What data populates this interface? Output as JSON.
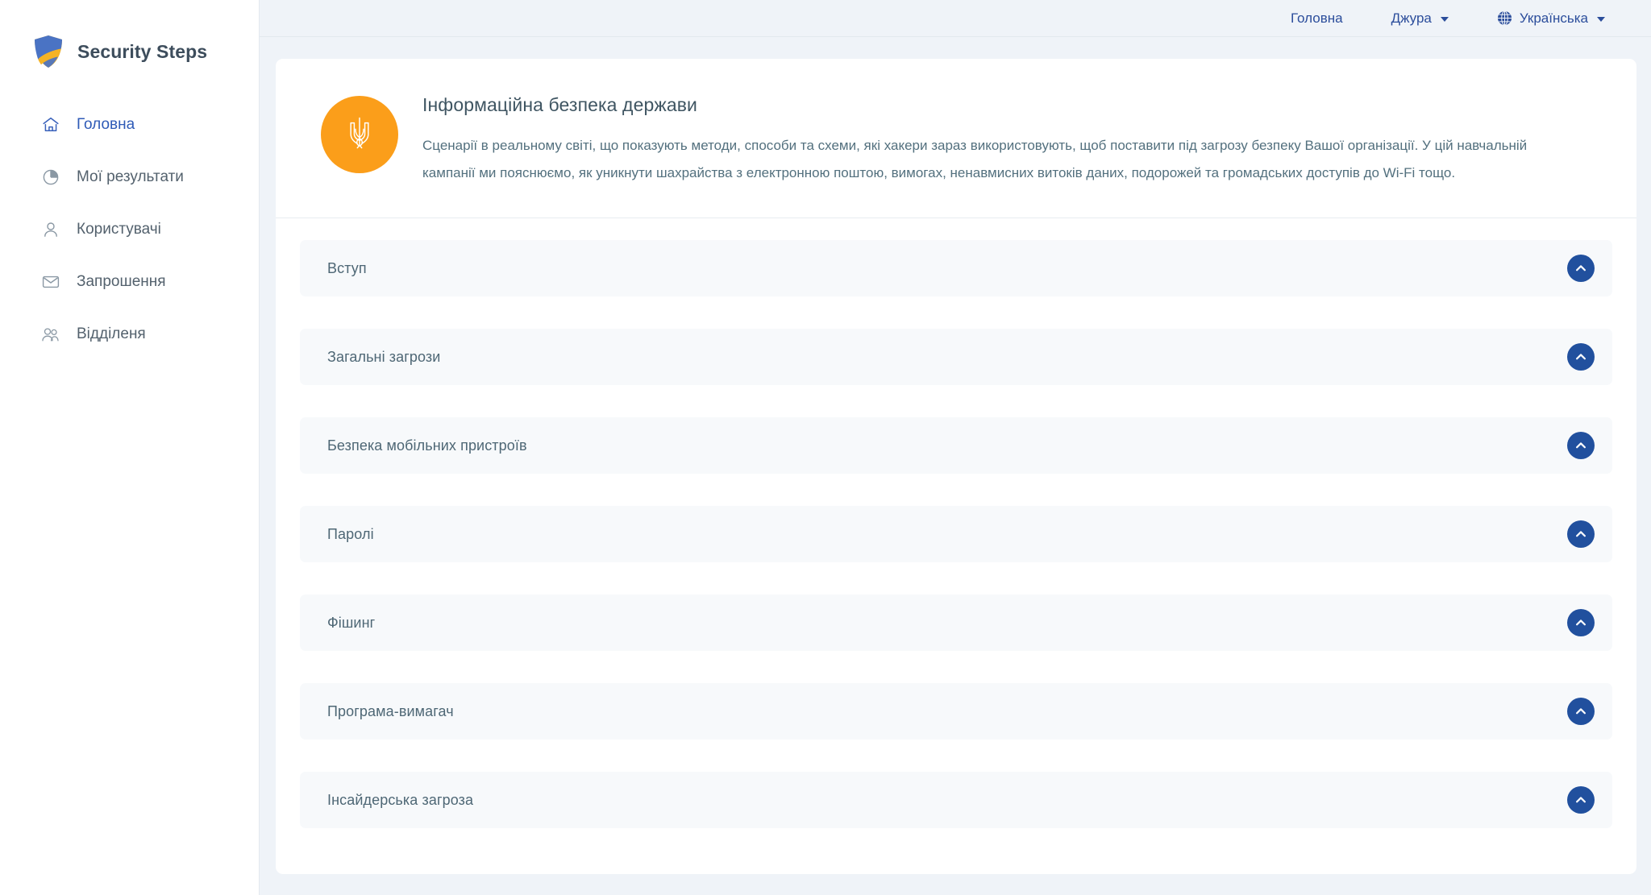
{
  "brand": {
    "name": "Security Steps",
    "logo_icon": "shield-logo",
    "colors": {
      "shield_blue": "#4a73c4",
      "shield_yellow": "#f5b324"
    }
  },
  "sidebar": {
    "items": [
      {
        "label": "Головна",
        "icon": "home-icon",
        "active": true
      },
      {
        "label": "Мої результати",
        "icon": "pie-chart-icon",
        "active": false
      },
      {
        "label": "Користувачі",
        "icon": "user-icon",
        "active": false
      },
      {
        "label": "Запрошення",
        "icon": "envelope-icon",
        "active": false
      },
      {
        "label": "Відділеня",
        "icon": "users-group-icon",
        "active": false
      }
    ]
  },
  "topbar": {
    "home_label": "Головна",
    "user_label": "Джура",
    "language_label": "Українська",
    "language_icon": "globe-icon",
    "caret_icon": "caret-down-icon",
    "link_color": "#2b4d9b"
  },
  "course": {
    "badge_icon": "ukraine-trident-icon",
    "badge_color": "#fb9e1a",
    "title": "Інформаційна безпека держави",
    "description": "Сценарії в реальному світі, що показують методи, способи та схеми, які хакери зараз використовують, щоб поставити під загрозу безпеку Вашої організації. У цій навчальній кампанії ми пояснюємо, як уникнути шахрайства з електронною поштою, вимогах, ненавмисних витоків даних, подорожей та громадських доступів до Wi-Fi тощо."
  },
  "accordion": {
    "toggle_icon": "chevron-up-icon",
    "toggle_color": "#21509e",
    "items": [
      {
        "title": "Вступ"
      },
      {
        "title": "Загальні загрози"
      },
      {
        "title": "Безпека мобільних пристроїв"
      },
      {
        "title": "Паролі"
      },
      {
        "title": "Фішинг"
      },
      {
        "title": "Програма-вимагач"
      },
      {
        "title": "Інсайдерська загроза"
      }
    ]
  }
}
